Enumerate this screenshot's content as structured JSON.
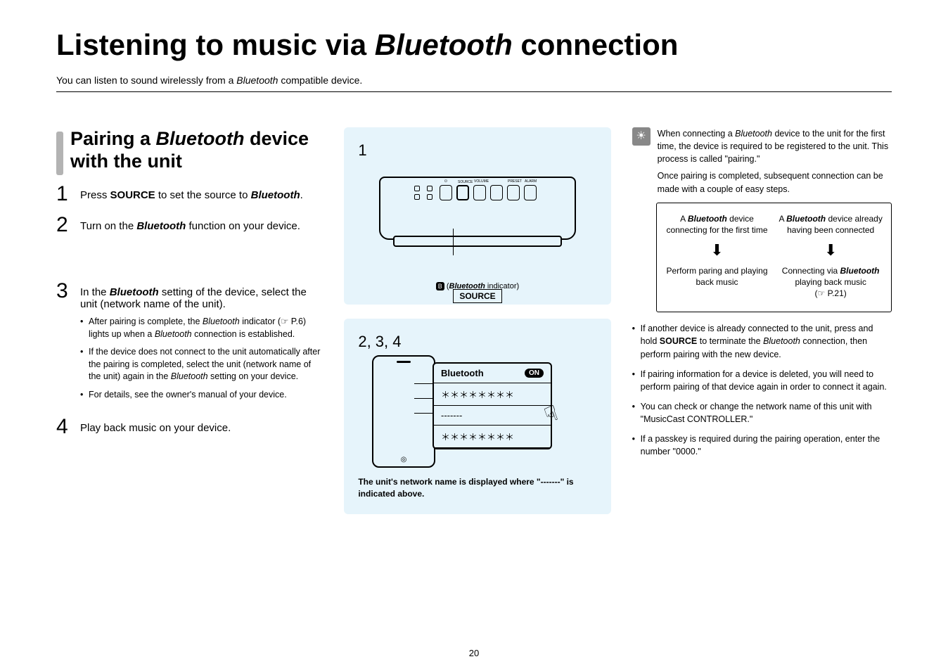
{
  "title_parts": {
    "a": "Listening to music via ",
    "b": "Bluetooth",
    "c": " connection"
  },
  "intro": {
    "a": "You can listen to sound wirelessly from a ",
    "b": "Bluetooth",
    "c": " compatible device."
  },
  "section": {
    "a": "Pairing a ",
    "b": "Bluetooth",
    "c": " device with the unit"
  },
  "steps": {
    "s1": {
      "num": "1",
      "a": "Press ",
      "b": "SOURCE",
      "c": " to set the source to ",
      "d": "Bluetooth",
      "e": "."
    },
    "s2": {
      "num": "2",
      "a": "Turn on the ",
      "b": "Bluetooth",
      "c": " function on your device."
    },
    "s3": {
      "num": "3",
      "a": "In the ",
      "b": "Bluetooth",
      "c": " setting of the device, select the unit (network name of the unit).",
      "b1a": "After pairing is complete, the ",
      "b1b": "Bluetooth",
      "b1c": " indicator (",
      "b1d": "☞",
      "b1e": " P.6) lights up when a ",
      "b1f": "Bluetooth",
      "b1g": " connection is established.",
      "b2a": "If the device does not connect to the unit automatically after the pairing is completed, select the unit (network name of the unit) again in the ",
      "b2b": "Bluetooth",
      "b2c": " setting on your device.",
      "b3": "For details, see the owner's manual of your device."
    },
    "s4": {
      "num": "4",
      "text": "Play back music on your device."
    }
  },
  "fig1": {
    "num": "1",
    "source_label": "SOURCE",
    "btlabels": {
      "source": "SOURCE",
      "vol": "VOLUME",
      "preset": "PRESET",
      "alarm": "ALARM"
    },
    "indic_a": " (",
    "indic_b": "Bluetooth",
    "indic_c": " indicator)"
  },
  "fig2": {
    "num": "2, 3, 4",
    "bt": "Bluetooth",
    "on": "ON",
    "stars": "＊＊＊＊＊＊＊＊",
    "dashes": "-------",
    "caption": "The unit's network name is displayed where \"-------\" is indicated above."
  },
  "tip": {
    "p1a": "When connecting a ",
    "p1b": "Bluetooth",
    "p1c": " device to the unit for the first time, the device is required to be registered to the unit. This process is called \"pairing.\"",
    "p2": "Once pairing is completed, subsequent connection can be made with a couple of easy steps."
  },
  "flow": {
    "left_top_a": "A ",
    "left_top_b": "Bluetooth",
    "left_top_c": " device connecting for the first time",
    "left_bot": "Perform paring and playing back music",
    "right_top_a": "A ",
    "right_top_b": "Bluetooth",
    "right_top_c": " device already having been connected",
    "right_bot_a": "Connecting via ",
    "right_bot_b": "Bluetooth",
    "right_bot_c": " playing back music",
    "right_ref": "(☞ P.21)"
  },
  "rbullets": {
    "i1a": "If another device is already connected to the unit, press and hold ",
    "i1b": "SOURCE",
    "i1c": " to terminate the ",
    "i1d": "Bluetooth",
    "i1e": " connection, then perform pairing with the new device.",
    "i2": "If pairing information for a device is deleted, you will need to perform pairing of that device again in order to connect it again.",
    "i3": "You can check or change the network name of this unit with \"MusicCast CONTROLLER.\"",
    "i4": "If a passkey is required during the pairing operation, enter the number \"0000.\""
  },
  "pagenum": "20"
}
